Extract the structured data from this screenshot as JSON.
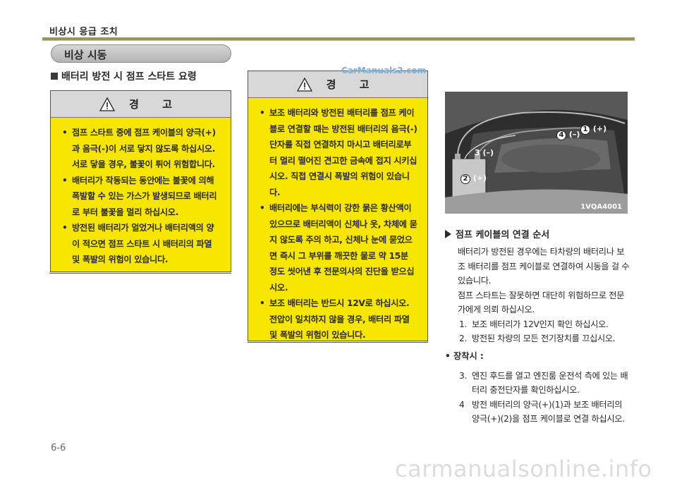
{
  "header": {
    "title": "비상시 응급 조치"
  },
  "section": {
    "label": "비상 시동"
  },
  "subheading": "배터리 방전 시 점프 스타트 요령",
  "watermark_top": "CarManuals2.com",
  "warning_left": {
    "title": "경 고",
    "items": [
      "점프 스타트 중에 점프 케이블의 양극(+)과 음극(-)이 서로 닿지 않도록 하십시오. 서로 닿을 경우, 불꽃이 튀어 위험합니다.",
      "배터리가 작동되는 동안에는 불꽃에 의해 폭발할 수 있는 가스가 발생되므로 배터리로 부터 불꽃을 멀리 하십시오.",
      "방전된 배터리가 얼었거나 배터리액의 양이 적으면 점프 스타트 시 배터리의 파열 및 폭발의 위험이 있습니다."
    ]
  },
  "warning_mid": {
    "title": "경 고",
    "items": [
      "보조 배터리와 방전된 배터리를 점프 케이블로 연결할 때는 방전된 배터리의 음극(-) 단자를 직접 연결하지 마시고 배터리로부터 멀리 떨어진 견고한 금속에 접지 시키십시오. 직접 연결시 폭발의 위험이 있습니다.",
      "배터리에는 부식력이 강한 묽은 황산액이 있으므로 배터리액이 신체나 옷, 차체에 묻지 않도록 주의 하고, 신체나 눈에 묻었으면 즉시 그 부위를 깨끗한 물로 약 15분 정도 씻어낸 후 전문의사의 진단을 받으십시오.",
      "보조 배터리는 반드시 12V로 하십시오. 전압이 일치하지 않을 경우, 배터리 파열 및 폭발의 위험이 있습니다."
    ]
  },
  "figure": {
    "code": "1VQA4001",
    "callouts": [
      "1",
      "(+)",
      "4",
      "(–)",
      "3",
      "(–)",
      "2",
      "(+)"
    ]
  },
  "right": {
    "heading": "점프 케이블의 연결 순서",
    "paragraphs": [
      "배터리가 방전된 경우에는 타차량의 배터리나 보조 배터리를 점프 케이블로 연결하여 시동을 걸 수 있습니다.",
      "점프 스타트는 잘못하면 대단히 위험하므로 전문가에게 의뢰 하십시오."
    ],
    "steps_a": [
      {
        "n": "1.",
        "t": "보조 배터리가 12V인지 확인 하십시오."
      },
      {
        "n": "2.",
        "t": "방전된 차량의 모든 전기장치를 끄십시오."
      }
    ],
    "bullet": "• 장착시 :",
    "steps_b": [
      {
        "n": "3.",
        "t": "엔진 후드를 열고 엔진룸 운전석 측에 있는 배터리 충전단자를 확인하십시오."
      },
      {
        "n": "4",
        "t": "방전 배터리의 양극(+)(1)과 보조 배터리의 양극(+)(2)을 점프 케이블로 연결 하십시오."
      }
    ]
  },
  "page_number": "6-6",
  "watermark_bottom": "carmanualsonline.info"
}
